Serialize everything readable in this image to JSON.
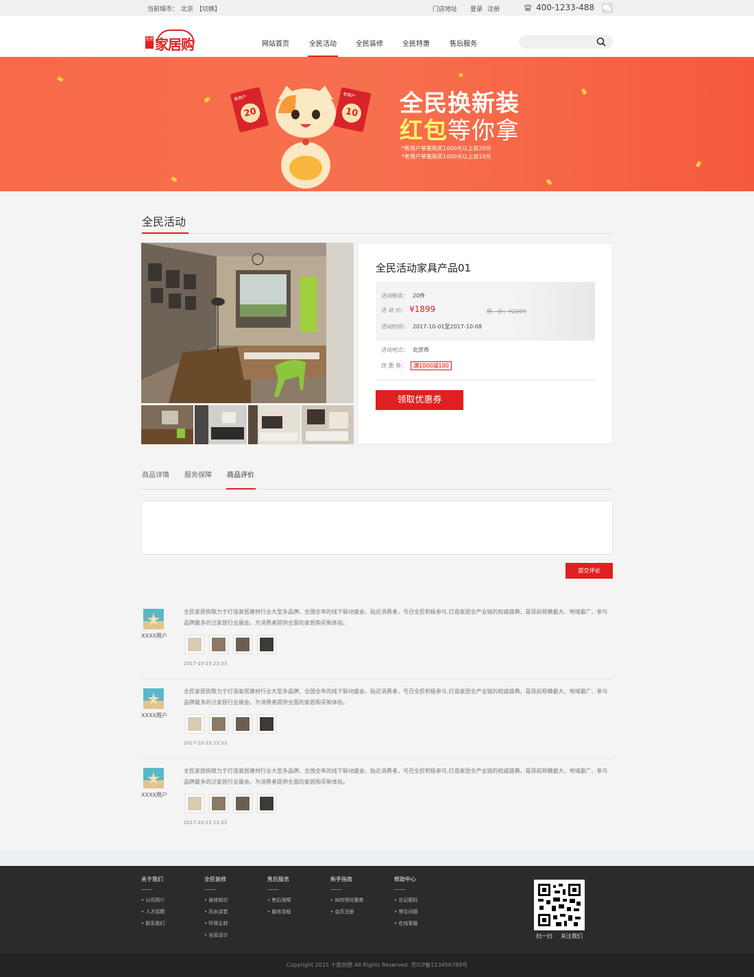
{
  "topbar": {
    "city_label": "当前城市：",
    "city": "北京",
    "switch": "【切换】",
    "store": "门店地址",
    "login": "登录",
    "register": "注册",
    "phone": "400-1233-488"
  },
  "header": {
    "logo_seal": "全民",
    "logo_text": "家居购",
    "nav": [
      "网站首页",
      "全民活动",
      "全民装修",
      "全民特惠",
      "售后服务"
    ],
    "active_nav": "全民活动"
  },
  "banner": {
    "title1": "全民换新装",
    "title2_em": "红包",
    "title2_rest": "等你拿",
    "note1": "*新用户单笔购买1000元以上获20元",
    "note2": "*老用户单笔购买1000元以上获10元",
    "redpack_left_tag": "新用户",
    "redpack_left_value": "20",
    "redpack_right_tag": "老用户",
    "redpack_right_value": "10"
  },
  "section": {
    "title": "全民活动"
  },
  "product": {
    "name": "全民活动家具产品01",
    "remain_label": "活动剩余：",
    "remain": "20件",
    "price_label": "活 动 价：",
    "price": "¥1899",
    "orig_label": "原　价：",
    "orig_price": "¥2099",
    "time_label": "活动时间：",
    "time": "2017-10-01至2017-10-08",
    "place_label": "活动地点：",
    "place": "北京市",
    "coupon_label": "优 惠 券：",
    "coupon": "满1000减100",
    "coupon_button": "领取优惠券"
  },
  "tabs": [
    "商品详情",
    "服务保障",
    "商品评价"
  ],
  "active_tab": "商品评价",
  "comment": {
    "submit": "提交评论"
  },
  "reviews": [
    {
      "user": "XXXX用户",
      "text": "全民家居购致力于打造家居建材行业大型多品牌、全国全年的线下联动盛会，贴近消费者，号召全民积极参与,打造家居全产业链的权威盛典，是目前规模最大、地域最广、参与品牌最多的泛家居行业展会。为消费者提供全面的家居购买新体验。",
      "date": "2017-10-23 23:33"
    },
    {
      "user": "XXXX用户",
      "text": "全民家居购致力于打造家居建材行业大型多品牌、全国全年的线下联动盛会，贴近消费者，号召全民积极参与,打造家居全产业链的权威盛典，是目前规模最大、地域最广、参与品牌最多的泛家居行业展会。为消费者提供全面的家居购买新体验。",
      "date": "2017-10-23 23:33"
    },
    {
      "user": "XXXX用户",
      "text": "全民家居购致力于打造家居建材行业大型多品牌、全国全年的线下联动盛会，贴近消费者，号召全民积极参与,打造家居全产业链的权威盛典，是目前规模最大、地域最广、参与品牌最多的泛家居行业展会。为消费者提供全面的家居购买新体验。",
      "date": "2017-10-23 23:33"
    }
  ],
  "footer": {
    "columns": [
      {
        "title": "关于我们",
        "links": [
          "公司简介",
          "人才招聘",
          "联系我们"
        ]
      },
      {
        "title": "全民装修",
        "links": [
          "装修知识",
          "风水讲堂",
          "环保主材",
          "全民设计"
        ]
      },
      {
        "title": "售后服务",
        "links": [
          "售后保障",
          "服务流程"
        ]
      },
      {
        "title": "新手指南",
        "links": [
          "如何领优惠券",
          "会员注册"
        ]
      },
      {
        "title": "帮助中心",
        "links": [
          "忘记密码",
          "常见问题",
          "在线客服"
        ]
      }
    ],
    "qr_scan": "扫一扫",
    "qr_follow": "关注我们",
    "copyright": "Copyright 2015 十度创想 All Rights Reserved. 京ICP备123456789号"
  },
  "colors": {
    "accent": "#e02020",
    "banner": "#f86a4a",
    "footer": "#2b2b2b"
  }
}
